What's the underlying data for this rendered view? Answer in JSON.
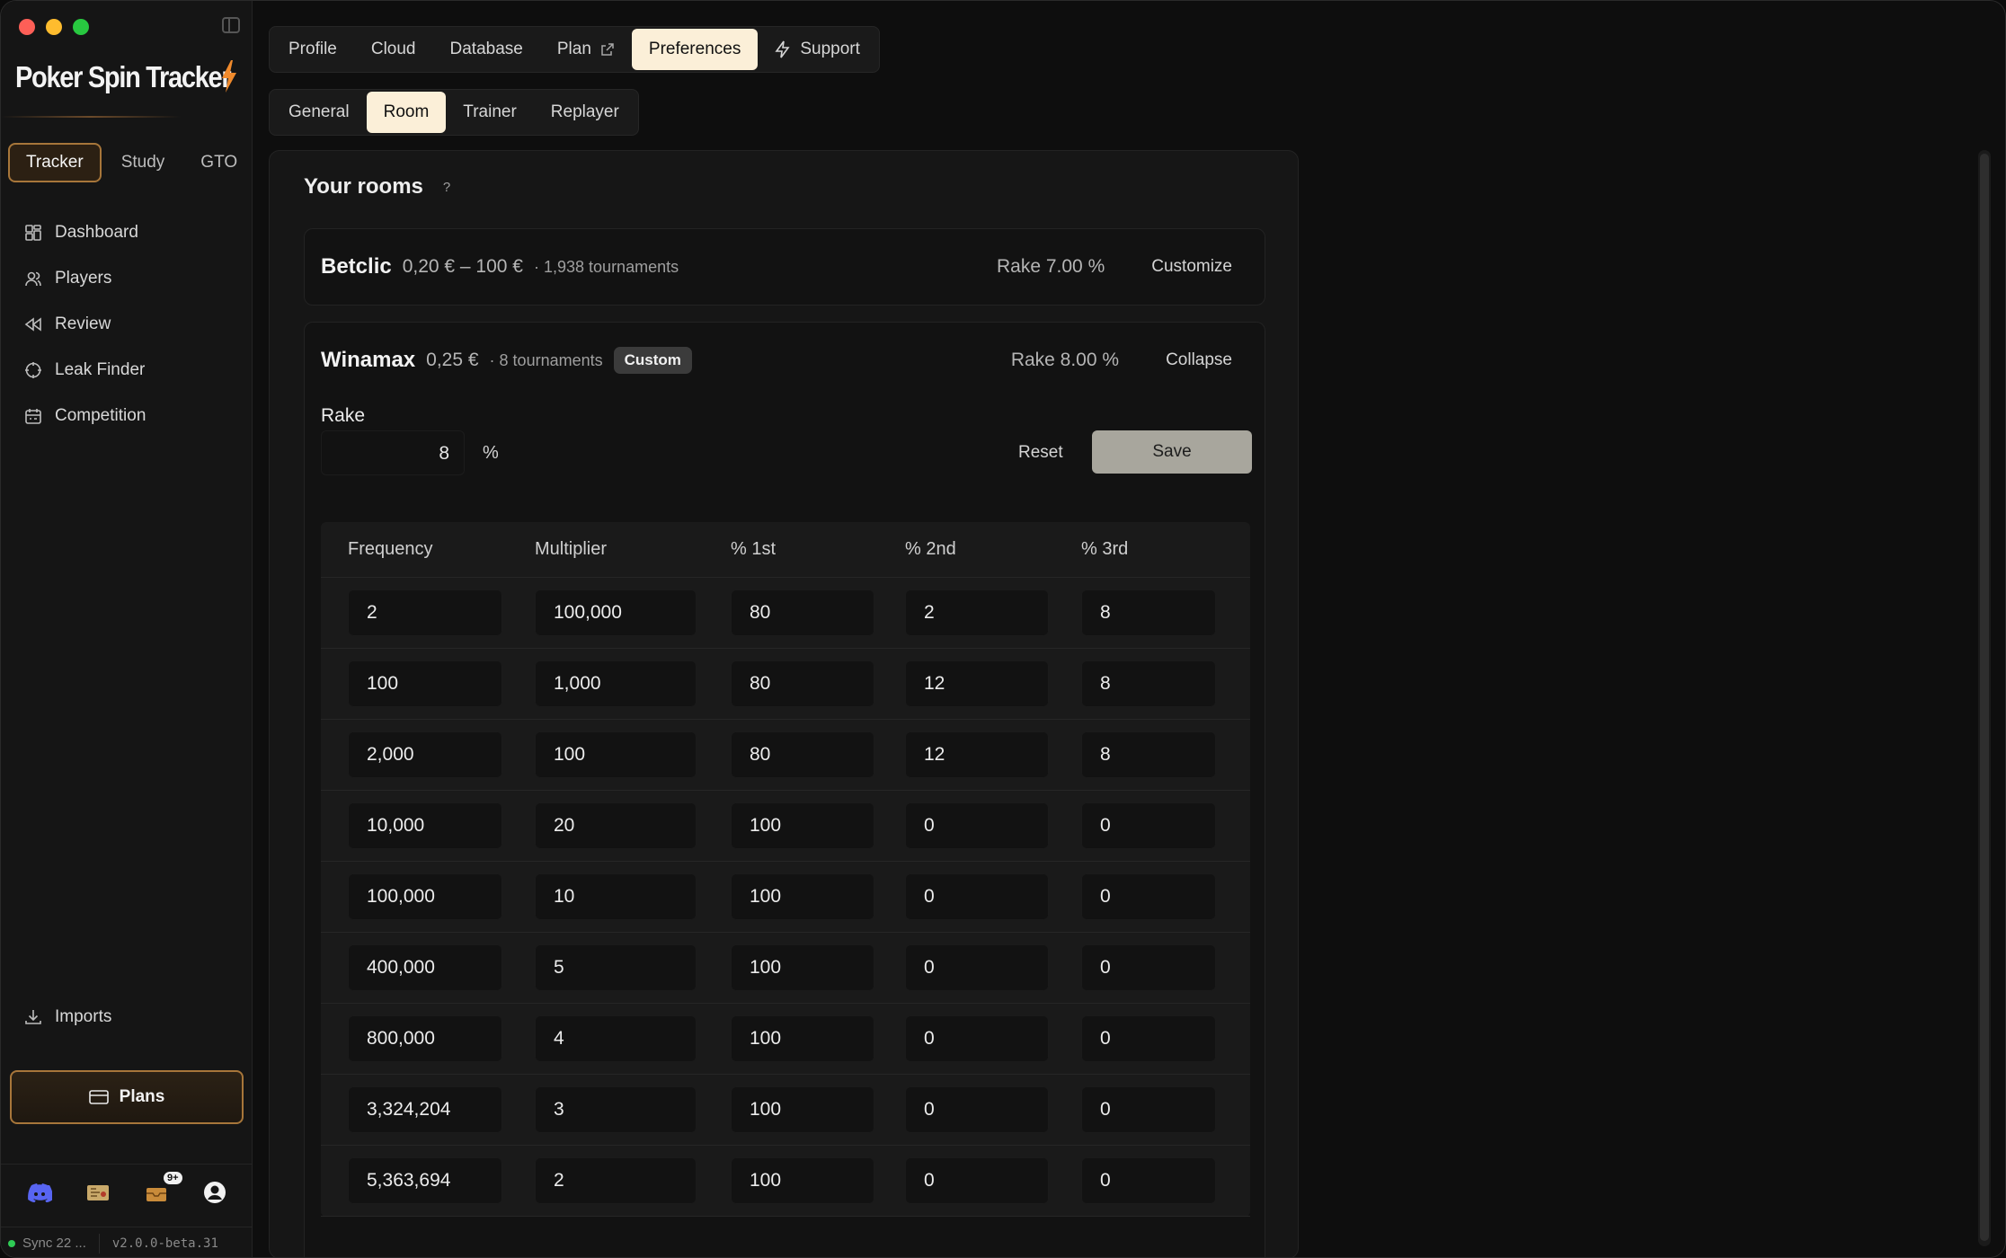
{
  "app": {
    "brand": "Poker Spin Tracker"
  },
  "sidebar": {
    "modes": [
      {
        "label": "Tracker",
        "active": true
      },
      {
        "label": "Study",
        "active": false
      },
      {
        "label": "GTO",
        "active": false
      }
    ],
    "nav": [
      {
        "label": "Dashboard",
        "icon": "grid-icon"
      },
      {
        "label": "Players",
        "icon": "users-icon"
      },
      {
        "label": "Review",
        "icon": "rewind-icon"
      },
      {
        "label": "Leak Finder",
        "icon": "crosshair-icon"
      },
      {
        "label": "Competition",
        "icon": "calendar-icon"
      }
    ],
    "imports_label": "Imports",
    "plans_label": "Plans",
    "notification_badge": "9+",
    "sync_status": "Sync 22 ...",
    "version": "v2.0.0-beta.31"
  },
  "tabs": [
    {
      "label": "Profile",
      "active": false
    },
    {
      "label": "Cloud",
      "active": false
    },
    {
      "label": "Database",
      "active": false
    },
    {
      "label": "Plan",
      "active": false,
      "external": true
    },
    {
      "label": "Preferences",
      "active": true
    },
    {
      "label": "Support",
      "active": false
    }
  ],
  "subtabs": [
    {
      "label": "General",
      "active": false
    },
    {
      "label": "Room",
      "active": true
    },
    {
      "label": "Trainer",
      "active": false
    },
    {
      "label": "Replayer",
      "active": false
    }
  ],
  "panel": {
    "title": "Your rooms",
    "help": "?",
    "rooms": [
      {
        "name": "Betclic",
        "range": "0,20 € – 100 €",
        "count": "· 1,938 tournaments",
        "rake": "Rake 7.00 %",
        "action": "Customize"
      },
      {
        "name": "Winamax",
        "range": "0,25 €",
        "count": "· 8 tournaments",
        "badge": "Custom",
        "rake": "Rake 8.00 %",
        "action": "Collapse"
      }
    ],
    "rake_editor": {
      "label": "Rake",
      "value": "8",
      "unit": "%",
      "reset_label": "Reset",
      "save_label": "Save"
    },
    "table": {
      "headers": [
        "Frequency",
        "Multiplier",
        "% 1st",
        "% 2nd",
        "% 3rd"
      ],
      "rows": [
        [
          "2",
          "100,000",
          "80",
          "2",
          "8"
        ],
        [
          "100",
          "1,000",
          "80",
          "12",
          "8"
        ],
        [
          "2,000",
          "100",
          "80",
          "12",
          "8"
        ],
        [
          "10,000",
          "20",
          "100",
          "0",
          "0"
        ],
        [
          "100,000",
          "10",
          "100",
          "0",
          "0"
        ],
        [
          "400,000",
          "5",
          "100",
          "0",
          "0"
        ],
        [
          "800,000",
          "4",
          "100",
          "0",
          "0"
        ],
        [
          "3,324,204",
          "3",
          "100",
          "0",
          "0"
        ],
        [
          "5,363,694",
          "2",
          "100",
          "0",
          "0"
        ]
      ]
    }
  }
}
